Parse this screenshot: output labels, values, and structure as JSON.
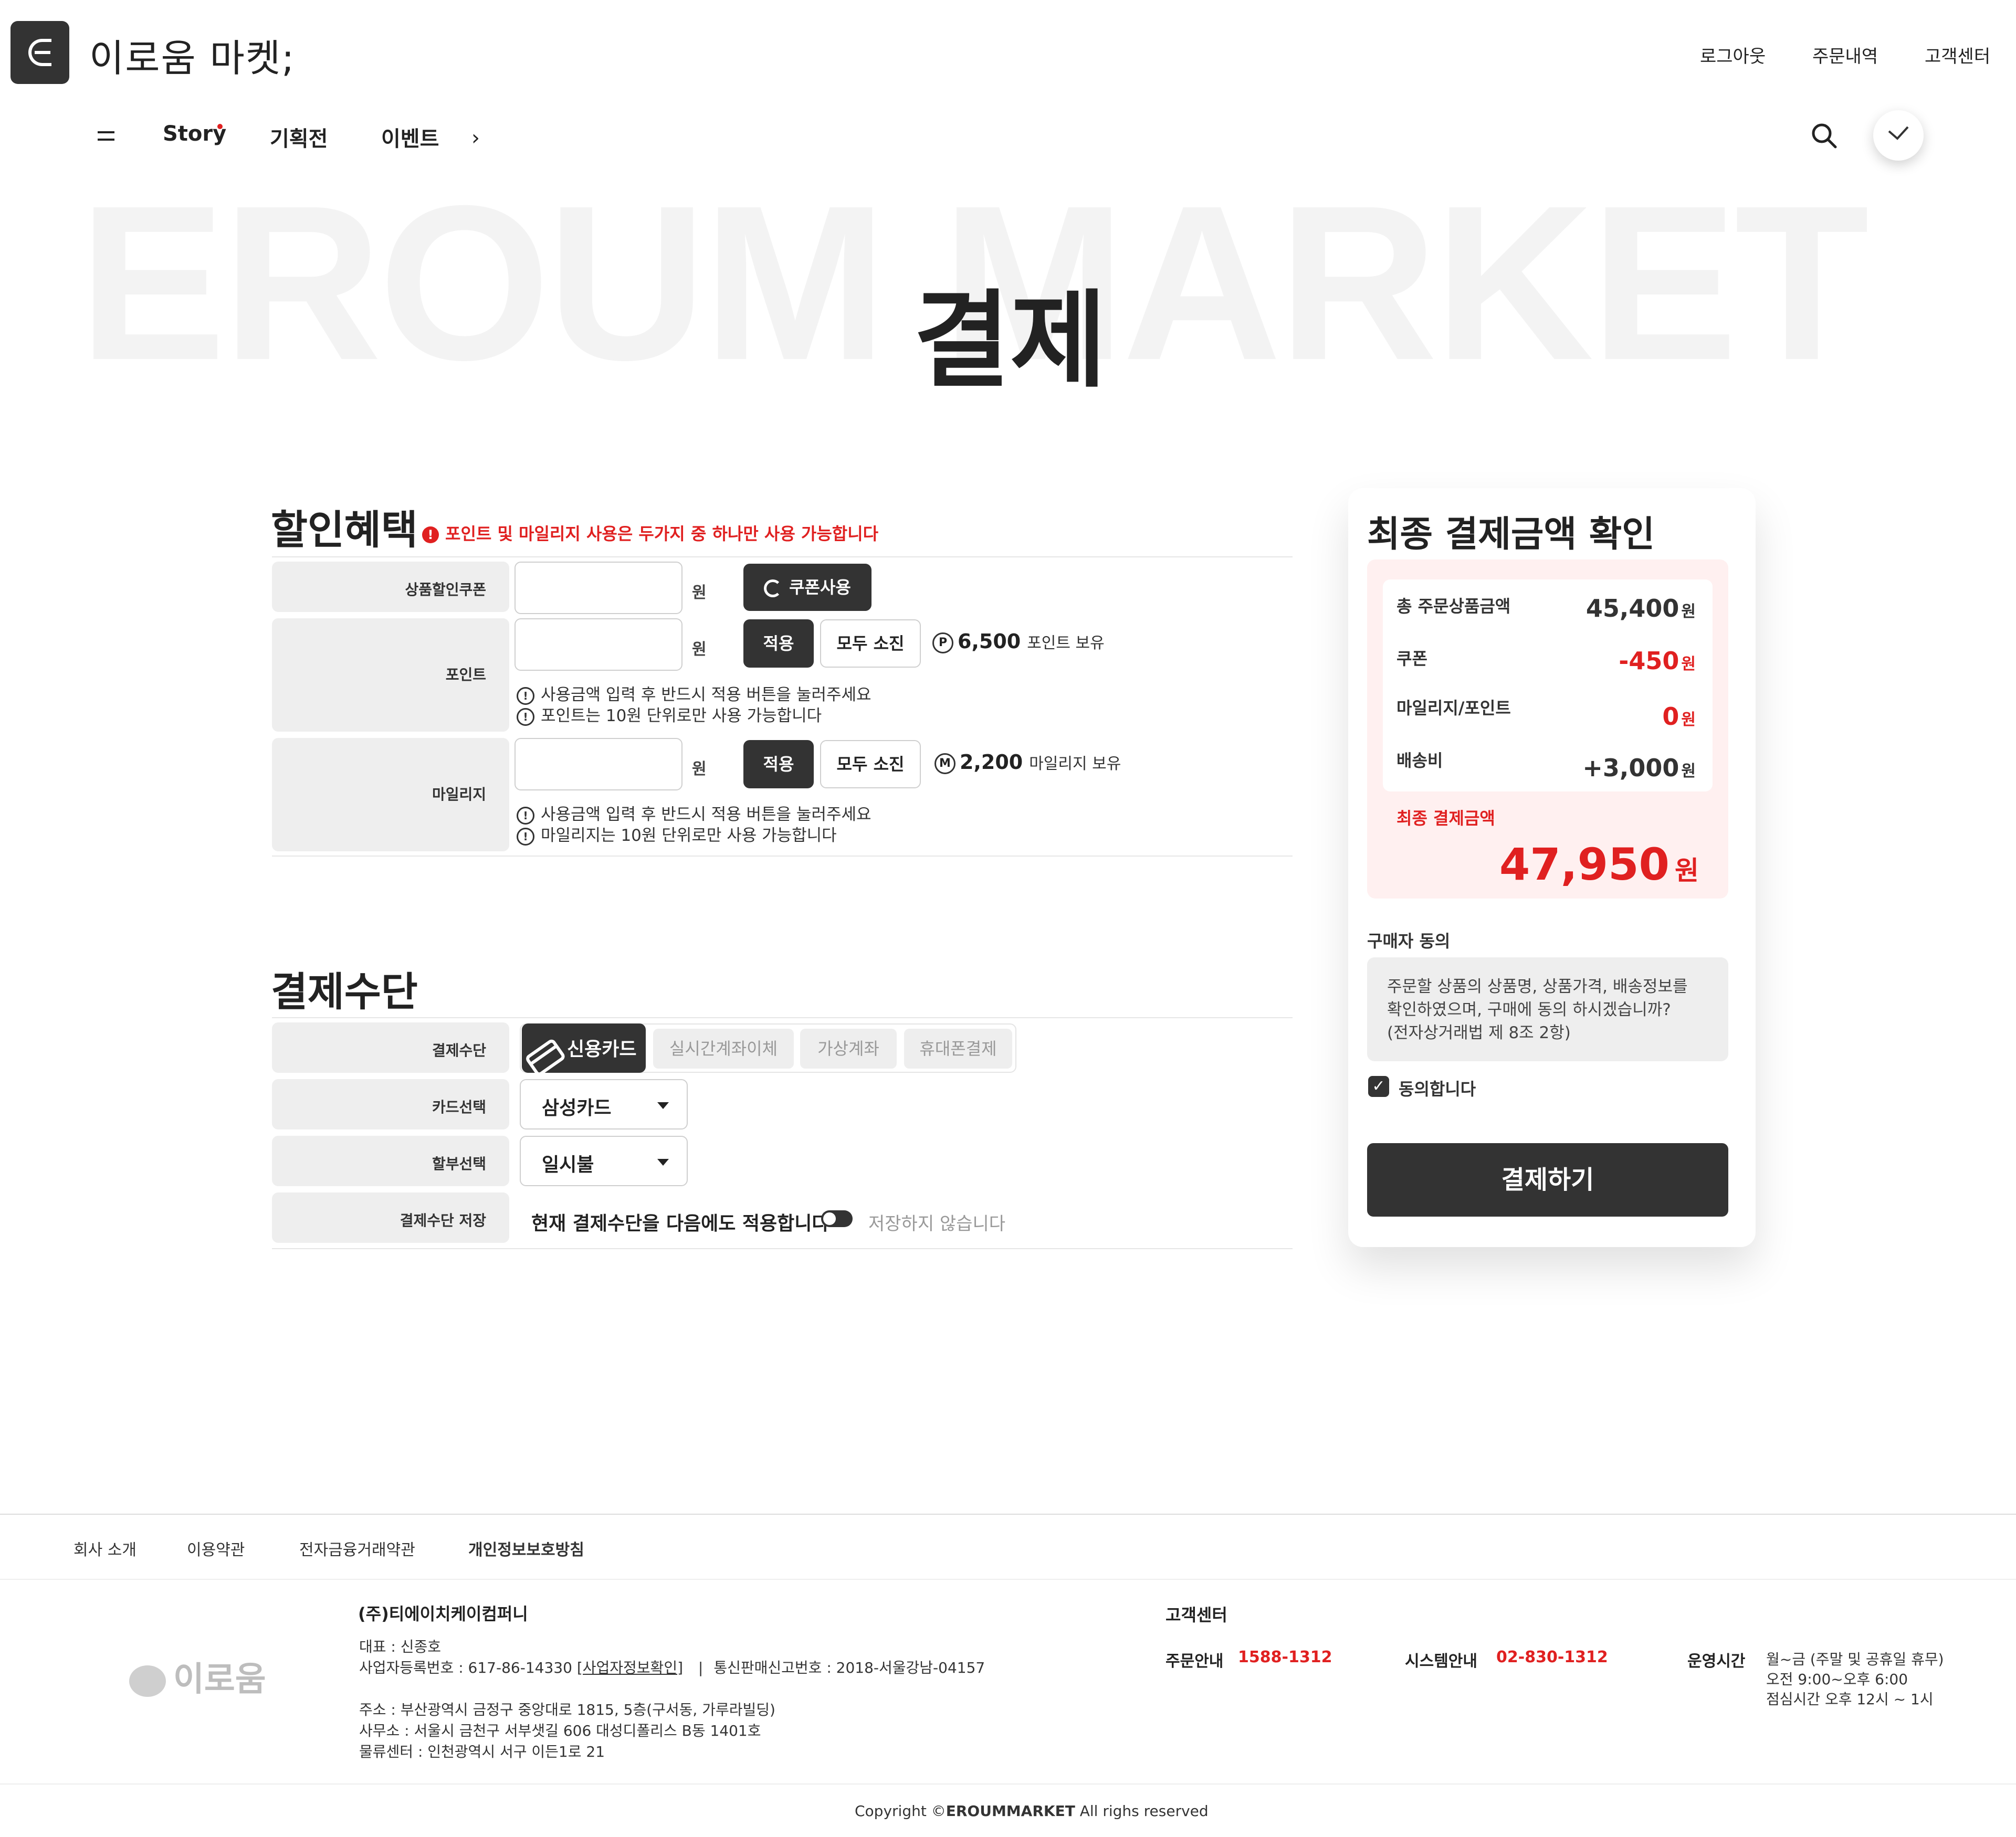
{
  "header": {
    "logo_text": "이로움 마켓;",
    "links": [
      "로그아웃",
      "주문내역",
      "고객센터"
    ],
    "nav": [
      "Story",
      "기획전",
      "이벤트"
    ],
    "chevron": "›"
  },
  "hero": {
    "bg_text": "EROUM MARKET",
    "title": "결제"
  },
  "discount": {
    "heading": "할인혜택",
    "warning": "포인트 및 마일리지 사용은 두가지 중 하나만 사용 가능합니다",
    "coupon": {
      "label": "상품할인쿠폰",
      "unit": "원",
      "button": "쿠폰사용"
    },
    "point": {
      "label": "포인트",
      "unit": "원",
      "apply": "적용",
      "use_all": "모두 소진",
      "coin": "P",
      "balance": "6,500",
      "balance_label": "포인트 보유",
      "notes": [
        "사용금액 입력 후 반드시 적용 버튼을 눌러주세요",
        "포인트는 10원 단위로만 사용 가능합니다"
      ]
    },
    "mileage": {
      "label": "마일리지",
      "unit": "원",
      "apply": "적용",
      "use_all": "모두 소진",
      "coin": "M",
      "balance": "2,200",
      "balance_label": "마일리지 보유",
      "notes": [
        "사용금액 입력 후 반드시 적용 버튼을 눌러주세요",
        "마일리지는 10원 단위로만 사용 가능합니다"
      ]
    }
  },
  "payment": {
    "heading": "결제수단",
    "method_label": "결제수단",
    "methods": [
      "신용카드",
      "실시간계좌이체",
      "가상계좌",
      "휴대폰결제"
    ],
    "selected_method": "신용카드",
    "card_label": "카드선택",
    "card_value": "삼성카드",
    "installment_label": "할부선택",
    "installment_value": "일시불",
    "save_label": "결제수단 저장",
    "save_text": "현재 결제수단을 다음에도 적용합니다",
    "save_state": "저장하지 않습니다"
  },
  "summary": {
    "heading": "최종 결제금액 확인",
    "rows": [
      {
        "label": "총 주문상품금액",
        "value": "45,400",
        "unit": "원"
      },
      {
        "label": "쿠폰",
        "value": "-450",
        "unit": "원"
      },
      {
        "label": "마일리지/포인트",
        "value": "0",
        "unit": "원"
      },
      {
        "label": "배송비",
        "value": "+3,000",
        "unit": "원"
      }
    ],
    "final_label": "최종 결제금액",
    "final_value": "47,950",
    "final_unit": "원",
    "agree_heading": "구매자 동의",
    "agree_text": "주문할 상품의 상품명, 상품가격, 배송정보를 확인하였으며, 구매에 동의 하시겠습니까?\n(전자상거래법 제 8조 2항)",
    "agree_check": "동의합니다",
    "pay_button": "결제하기",
    "colors": {
      "accent_red": "#e02020",
      "dark": "#333333",
      "pink_bg": "#fff0f0"
    }
  },
  "footer": {
    "nav": [
      "회사 소개",
      "이용약관",
      "전자금융거래약관",
      "개인정보보호방침"
    ],
    "logo": "이로움",
    "company": "(주)티에이치케이컴퍼니",
    "ceo": "대표 : 신종호",
    "biz_no": "사업자등록번호 : 617-86-14330",
    "biz_link": "[사업자정보확인]",
    "sep": "|",
    "mail_order": "통신판매신고번호 : 2018-서울강남-04157",
    "address": "주소 : 부산광역시 금정구 중앙대로 1815, 5층(구서동, 가루라빌딩)",
    "office": "사무소 : 서울시 금천구 서부샛길 606 대성디폴리스 B동 1401호",
    "logistics": "물류센터 : 인천광역시 서구 이든1로 21",
    "cs_heading": "고객센터",
    "order_label": "주문안내",
    "order_phone": "1588-1312",
    "system_label": "시스템안내",
    "system_phone": "02-830-1312",
    "hours_label": "운영시간",
    "hours": [
      "월~금 (주말 및 공휴일 휴무)",
      "오전 9:00~오후 6:00",
      "점심시간 오후 12시 ~ 1시"
    ],
    "copyright_pre": "Copyright ©",
    "copyright_brand": "EROUMMARKET",
    "copyright_post": " All righs reserved"
  }
}
